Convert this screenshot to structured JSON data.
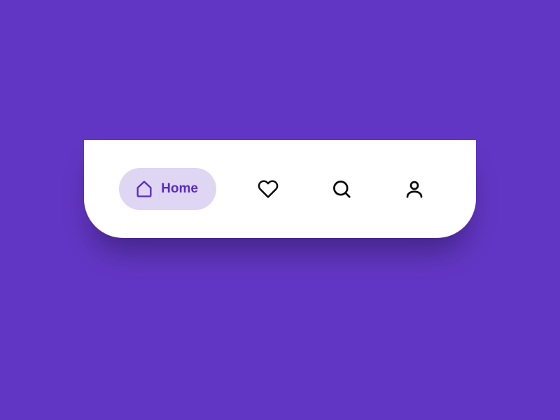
{
  "colors": {
    "background": "#6236c4",
    "navbar": "#ffffff",
    "active_pill": "#ded6f3",
    "accent": "#5b2cc3",
    "icon_inactive": "#0a0a0a"
  },
  "nav": {
    "items": [
      {
        "id": "home",
        "label": "Home",
        "icon": "home-icon",
        "active": true
      },
      {
        "id": "favorites",
        "label": "Favorites",
        "icon": "heart-icon",
        "active": false
      },
      {
        "id": "search",
        "label": "Search",
        "icon": "search-icon",
        "active": false
      },
      {
        "id": "profile",
        "label": "Profile",
        "icon": "user-icon",
        "active": false
      }
    ]
  }
}
